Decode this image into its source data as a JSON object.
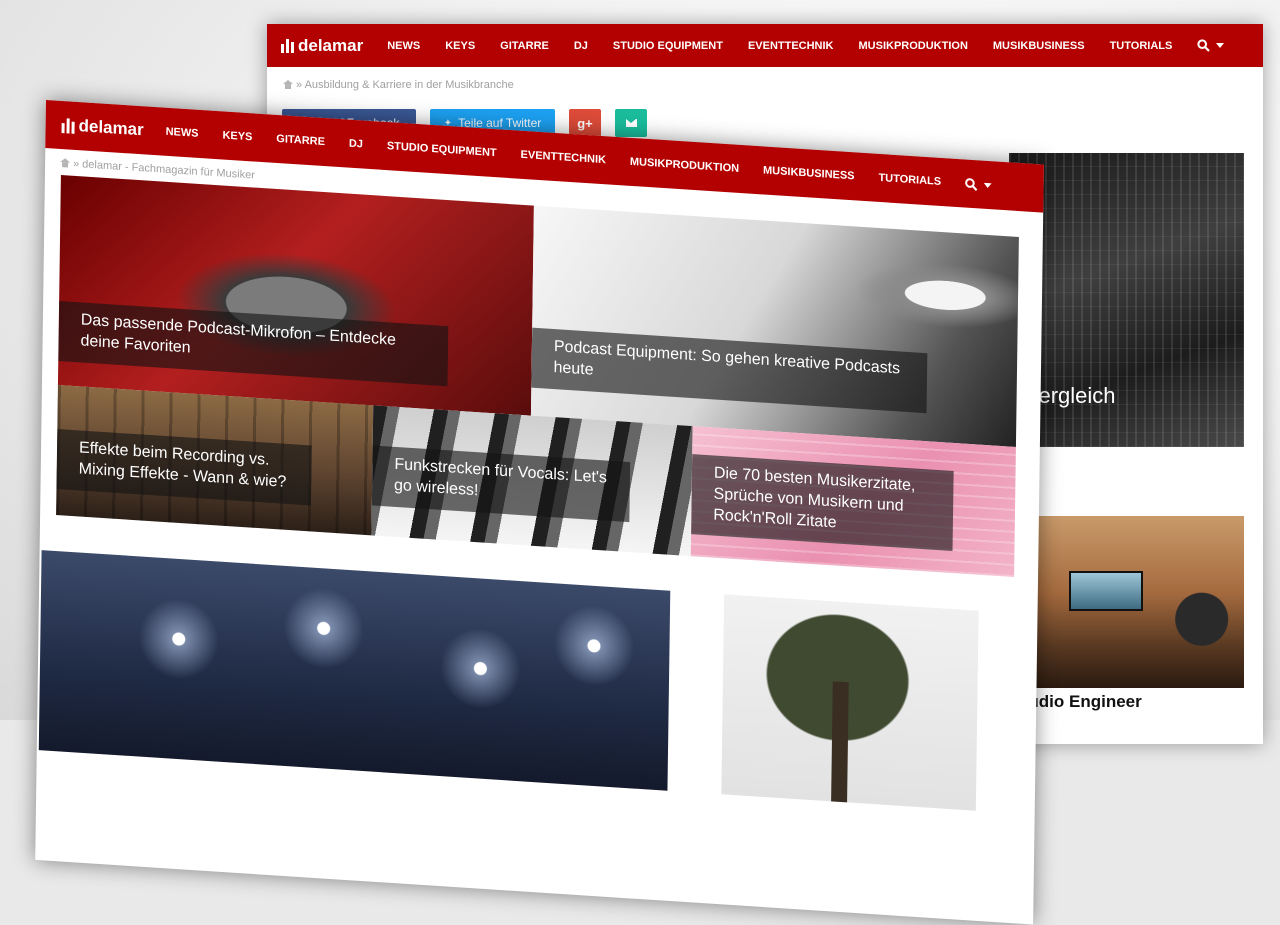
{
  "nav": {
    "logo": "delamar",
    "items": [
      "NEWS",
      "KEYS",
      "GITARRE",
      "DJ",
      "STUDIO EQUIPMENT",
      "EVENTTECHNIK",
      "MUSIKPRODUKTION",
      "MUSIKBUSINESS",
      "TUTORIALS"
    ]
  },
  "back_page": {
    "breadcrumb": "Ausbildung & Karriere in der Musikbranche",
    "share": {
      "facebook": "Teile auf Facebook",
      "twitter": "Teile auf Twitter",
      "googleplus": "g+"
    },
    "feature_title_partial": "Vergleich",
    "side_caption_partial": "d: Audio Engineer"
  },
  "front_page": {
    "breadcrumb": "delamar - Fachmagazin für Musiker",
    "tiles": [
      "Das passende Podcast-Mikrofon – Entdecke deine Favoriten",
      "Podcast Equipment: So gehen kreative Podcasts heute",
      "Effekte beim Recording vs. Mixing Effekte - Wann & wie?",
      "Funkstrecken für Vocals: Let's go wireless!",
      "Die 70 besten Musikerzitate, Sprüche von Musikern und Rock'n'Roll Zitate"
    ]
  },
  "colors": {
    "brand_red": "#b30000",
    "facebook_blue": "#3b5998",
    "twitter_blue": "#1da1f2",
    "googleplus_red": "#dd4b39",
    "mail_green": "#1abc9c"
  }
}
